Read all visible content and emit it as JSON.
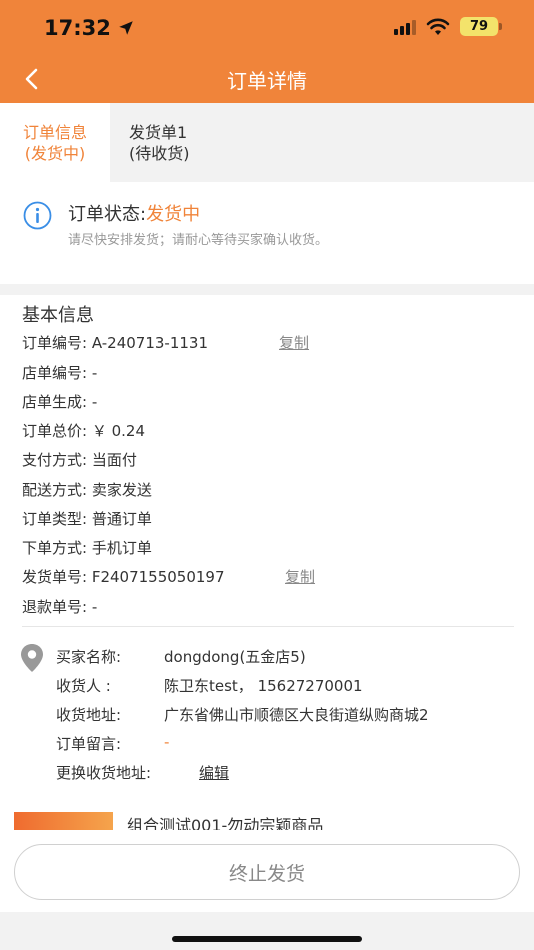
{
  "status_bar": {
    "time": "17:32",
    "battery": "79"
  },
  "nav": {
    "title": "订单详情"
  },
  "tabs": [
    {
      "line1": "订单信息",
      "line2": "(发货中)"
    },
    {
      "line1": "发货单1",
      "line2": "(待收货)"
    }
  ],
  "order_status": {
    "label": "订单状态:",
    "value": "发货中",
    "hint": "请尽快安排发货；请耐心等待买家确认收货。"
  },
  "basic_info": {
    "title": "基本信息",
    "order_no": "订单编号: A-240713-1131",
    "copy_label": "复制",
    "store_no": "店单编号: -",
    "store_gen": "店单生成: -",
    "total": "订单总价: ￥ 0.24",
    "payment": "支付方式: 当面付",
    "delivery": "配送方式: 卖家发送",
    "order_type": "订单类型: 普通订单",
    "order_method": "下单方式: 手机订单",
    "ship_no": "发货单号: F2407155050197",
    "ship_copy_label": "复制",
    "refund_no": "退款单号: -"
  },
  "buyer": {
    "name_label": "买家名称:",
    "name": "dongdong(五金店5)",
    "receiver_label": "收货人 :",
    "receiver": "陈卫东test， 15627270001",
    "address_label": "收货地址:",
    "address": "广东省佛山市顺德区大良街道纵购商城2",
    "note_label": "订单留言:",
    "note": "-",
    "change_label": "更换收货地址:",
    "edit": "编辑"
  },
  "product": {
    "name": "组合测试001-勿动宗颖商品"
  },
  "footer": {
    "stop_button": "终止发货"
  },
  "colors": {
    "accent": "#f0843a",
    "info_blue": "#3a8ee6"
  }
}
